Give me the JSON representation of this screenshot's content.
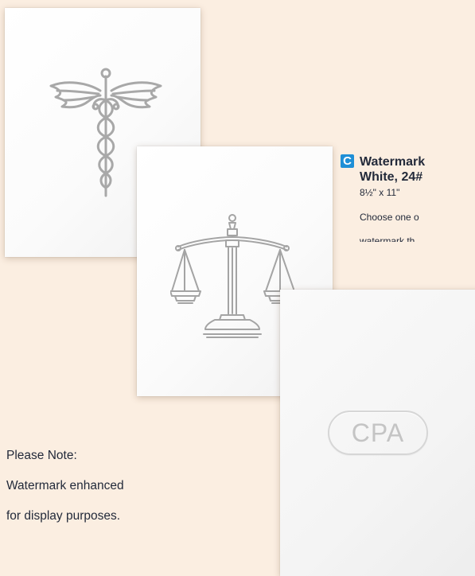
{
  "product": {
    "letter": "C",
    "title_line1": "Watermark",
    "title_line2": "White, 24#",
    "size": "8½\" x 11\"",
    "description_line1": "Choose one o",
    "description_line2": "watermark th"
  },
  "samples": {
    "cpa_watermark_text": "CPA"
  },
  "note": {
    "line1": "Please Note:",
    "line2": "Watermark enhanced",
    "line3": "for display purposes."
  },
  "icons": {
    "medical": "caduceus-icon",
    "legal": "scales-of-justice-icon"
  },
  "colors": {
    "background": "#fbeee1",
    "accent": "#1f8fd6",
    "text": "#232a3a",
    "watermark_gray": "#a9a9a9"
  }
}
